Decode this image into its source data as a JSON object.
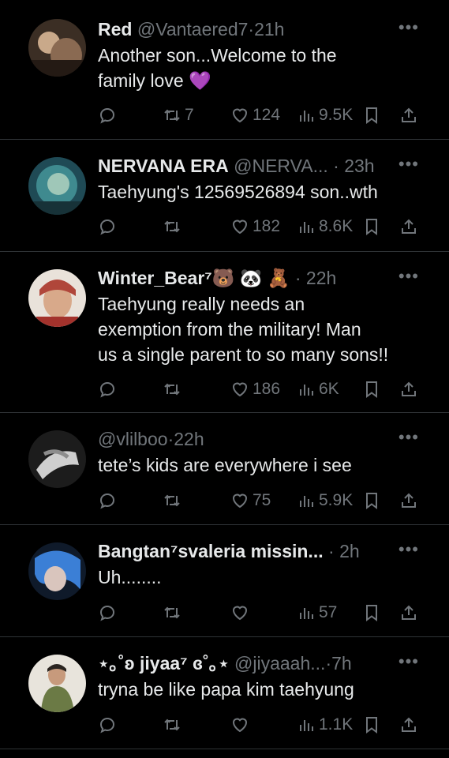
{
  "colors": {
    "background": "#000000",
    "text": "#e7e9ea",
    "muted": "#71767b",
    "divider": "#2f3336"
  },
  "tweets": [
    {
      "name": "Red",
      "handle": "@Vantaered7",
      "time": "21h",
      "text_line1": "Another son...Welcome to the",
      "text_line2": "family love 💜",
      "text_line3": "",
      "retweets": "7",
      "likes": "124",
      "views": "9.5K",
      "more": "•••"
    },
    {
      "name": "NERVANA ERA",
      "handle": "@NERVA...",
      "time": "23h",
      "text_line1": "Taehyung's 12569526894 son..wth",
      "text_line2": "",
      "text_line3": "",
      "retweets": "",
      "likes": "182",
      "views": "8.6K",
      "more": "•••"
    },
    {
      "name": "Winter_Bear⁷🐻 🐼 🧸",
      "handle": "",
      "time": "22h",
      "text_line1": "Taehyung really needs an",
      "text_line2": "exemption from the military! Man",
      "text_line3": "us a single parent to so many sons!!",
      "retweets": "",
      "likes": "186",
      "views": "6K",
      "more": "•••"
    },
    {
      "name": "",
      "handle": "@vlilboo",
      "time": "22h",
      "text_line1": "tete’s kids are everywhere i see",
      "text_line2": "",
      "text_line3": "",
      "retweets": "",
      "likes": "75",
      "views": "5.9K",
      "more": "•••"
    },
    {
      "name": "Bangtan⁷svaleria missin...",
      "handle": "",
      "time": "2h",
      "text_line1": "Uh........",
      "text_line2": "",
      "text_line3": "",
      "retweets": "",
      "likes": "",
      "views": "57",
      "more": "•••"
    },
    {
      "name": "⋆｡˚ʚ jiyaa⁷ ɞ˚｡⋆",
      "handle": "@jiyaaah...",
      "time": "7h",
      "text_line1": "tryna be like papa kim taehyung",
      "text_line2": "",
      "text_line3": "",
      "retweets": "",
      "likes": "",
      "views": "1.1K",
      "more": "•••"
    }
  ]
}
